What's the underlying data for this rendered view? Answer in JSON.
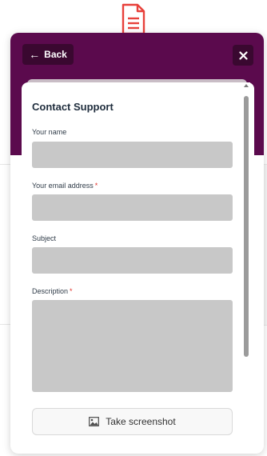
{
  "header": {
    "back_label": "Back"
  },
  "form": {
    "title": "Contact Support",
    "fields": [
      {
        "label": "Your name",
        "required": false,
        "required_mark": ""
      },
      {
        "label": "Your email address",
        "required": true,
        "required_mark": "*"
      },
      {
        "label": "Subject",
        "required": false,
        "required_mark": ""
      },
      {
        "label": "Description",
        "required": true,
        "required_mark": "*"
      }
    ],
    "screenshot_button_label": "Take screenshot"
  },
  "icons": {
    "top": "document-icon",
    "back": "arrow-left-icon",
    "close": "close-icon",
    "screenshot": "image-icon",
    "scroll": "scroll-up-arrow-icon"
  },
  "colors": {
    "header_bg": "#5b0a4d",
    "header_button_bg": "#3a0830",
    "required_star": "#e0322a",
    "field_fill": "#c8c8c8",
    "icon_accent": "#e8413b"
  }
}
